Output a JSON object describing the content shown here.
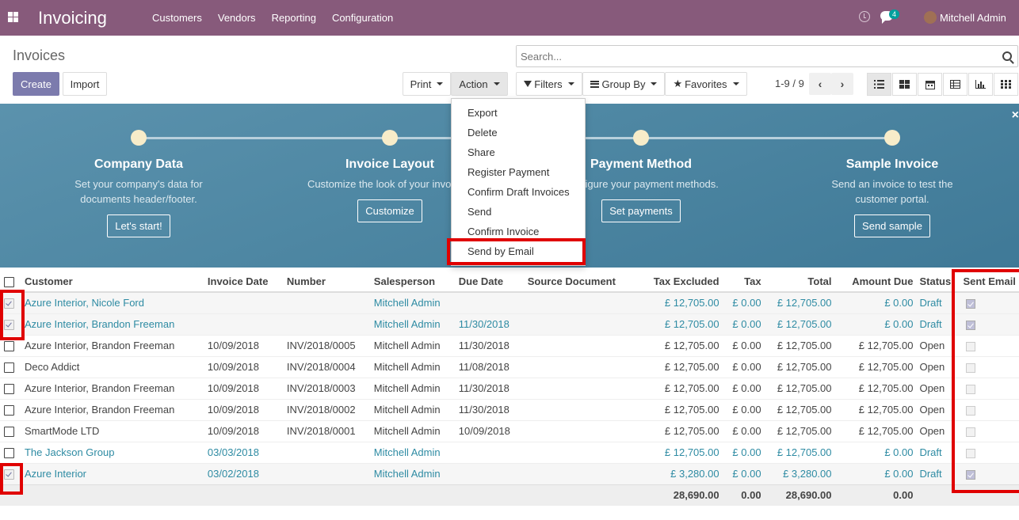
{
  "app": {
    "name": "Invoicing",
    "menu": [
      "Customers",
      "Vendors",
      "Reporting",
      "Configuration"
    ]
  },
  "systray": {
    "message_count": "4",
    "user": "Mitchell Admin"
  },
  "page": {
    "title": "Invoices",
    "search_placeholder": "Search...",
    "pager": "1-9 / 9"
  },
  "buttons": {
    "create": "Create",
    "import": "Import",
    "print": "Print",
    "action": "Action",
    "filters": "Filters",
    "group_by": "Group By",
    "favorites": "Favorites"
  },
  "action_menu": [
    "Export",
    "Delete",
    "Share",
    "Register Payment",
    "Confirm Draft Invoices",
    "Send",
    "Confirm Invoice",
    "Send by Email"
  ],
  "onboarding": {
    "steps": [
      {
        "title": "Company Data",
        "text": "Set your company's data for documents header/footer.",
        "button": "Let's start!"
      },
      {
        "title": "Invoice Layout",
        "text": "Customize the look of your invoices.",
        "button": "Customize"
      },
      {
        "title": "Payment Method",
        "text": "Configure your payment methods.",
        "button": "Set payments"
      },
      {
        "title": "Sample Invoice",
        "text": "Send an invoice to test the customer portal.",
        "button": "Send sample"
      }
    ]
  },
  "table": {
    "headers": [
      "Customer",
      "Invoice Date",
      "Number",
      "Salesperson",
      "Due Date",
      "Source Document",
      "Tax Excluded",
      "Tax",
      "Total",
      "Amount Due",
      "Status",
      "Sent Email"
    ],
    "rows": [
      {
        "selected": true,
        "customer": "Azure Interior, Nicole Ford",
        "invoice_date": "",
        "number": "",
        "salesperson": "Mitchell Admin",
        "due_date": "",
        "source": "",
        "tax_excluded": "£ 12,705.00",
        "tax": "£ 0.00",
        "total": "£ 12,705.00",
        "amount_due": "£ 0.00",
        "status": "Draft",
        "sent_email": true
      },
      {
        "selected": true,
        "customer": "Azure Interior, Brandon Freeman",
        "invoice_date": "",
        "number": "",
        "salesperson": "Mitchell Admin",
        "due_date": "11/30/2018",
        "source": "",
        "tax_excluded": "£ 12,705.00",
        "tax": "£ 0.00",
        "total": "£ 12,705.00",
        "amount_due": "£ 0.00",
        "status": "Draft",
        "sent_email": true
      },
      {
        "selected": false,
        "customer": "Azure Interior, Brandon Freeman",
        "invoice_date": "10/09/2018",
        "number": "INV/2018/0005",
        "salesperson": "Mitchell Admin",
        "due_date": "11/30/2018",
        "source": "",
        "tax_excluded": "£ 12,705.00",
        "tax": "£ 0.00",
        "total": "£ 12,705.00",
        "amount_due": "£ 12,705.00",
        "status": "Open",
        "sent_email": false
      },
      {
        "selected": false,
        "customer": "Deco Addict",
        "invoice_date": "10/09/2018",
        "number": "INV/2018/0004",
        "salesperson": "Mitchell Admin",
        "due_date": "11/08/2018",
        "source": "",
        "tax_excluded": "£ 12,705.00",
        "tax": "£ 0.00",
        "total": "£ 12,705.00",
        "amount_due": "£ 12,705.00",
        "status": "Open",
        "sent_email": false
      },
      {
        "selected": false,
        "customer": "Azure Interior, Brandon Freeman",
        "invoice_date": "10/09/2018",
        "number": "INV/2018/0003",
        "salesperson": "Mitchell Admin",
        "due_date": "11/30/2018",
        "source": "",
        "tax_excluded": "£ 12,705.00",
        "tax": "£ 0.00",
        "total": "£ 12,705.00",
        "amount_due": "£ 12,705.00",
        "status": "Open",
        "sent_email": false
      },
      {
        "selected": false,
        "customer": "Azure Interior, Brandon Freeman",
        "invoice_date": "10/09/2018",
        "number": "INV/2018/0002",
        "salesperson": "Mitchell Admin",
        "due_date": "11/30/2018",
        "source": "",
        "tax_excluded": "£ 12,705.00",
        "tax": "£ 0.00",
        "total": "£ 12,705.00",
        "amount_due": "£ 12,705.00",
        "status": "Open",
        "sent_email": false
      },
      {
        "selected": false,
        "customer": "SmartMode LTD",
        "invoice_date": "10/09/2018",
        "number": "INV/2018/0001",
        "salesperson": "Mitchell Admin",
        "due_date": "10/09/2018",
        "source": "",
        "tax_excluded": "£ 12,705.00",
        "tax": "£ 0.00",
        "total": "£ 12,705.00",
        "amount_due": "£ 12,705.00",
        "status": "Open",
        "sent_email": false
      },
      {
        "selected": false,
        "customer": "The Jackson Group",
        "invoice_date": "03/03/2018",
        "number": "",
        "salesperson": "Mitchell Admin",
        "due_date": "",
        "source": "",
        "tax_excluded": "£ 12,705.00",
        "tax": "£ 0.00",
        "total": "£ 12,705.00",
        "amount_due": "£ 0.00",
        "status": "Draft",
        "sent_email": false
      },
      {
        "selected": true,
        "customer": "Azure Interior",
        "invoice_date": "03/02/2018",
        "number": "",
        "salesperson": "Mitchell Admin",
        "due_date": "",
        "source": "",
        "tax_excluded": "£ 3,280.00",
        "tax": "£ 0.00",
        "total": "£ 3,280.00",
        "amount_due": "£ 0.00",
        "status": "Draft",
        "sent_email": true
      }
    ],
    "totals": {
      "tax_excluded": "28,690.00",
      "tax": "0.00",
      "total": "28,690.00",
      "amount_due": "0.00"
    }
  },
  "colors": {
    "brand": "#875a7b",
    "primary_button": "#7c7bad",
    "draft_link": "#2e8ba3",
    "highlight": "#e00000"
  }
}
